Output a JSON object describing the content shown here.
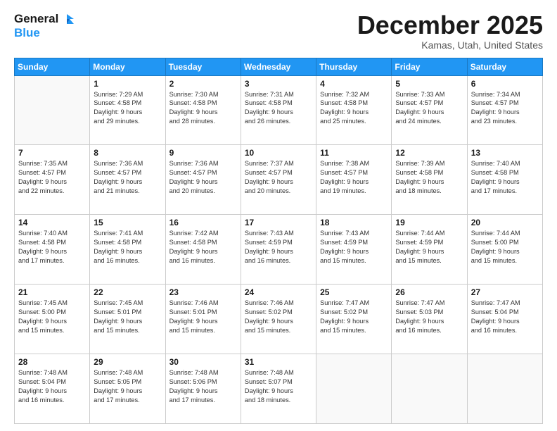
{
  "header": {
    "logo_line1": "General",
    "logo_line2": "Blue",
    "month_title": "December 2025",
    "location": "Kamas, Utah, United States"
  },
  "weekdays": [
    "Sunday",
    "Monday",
    "Tuesday",
    "Wednesday",
    "Thursday",
    "Friday",
    "Saturday"
  ],
  "weeks": [
    [
      {
        "day": "",
        "info": ""
      },
      {
        "day": "1",
        "info": "Sunrise: 7:29 AM\nSunset: 4:58 PM\nDaylight: 9 hours\nand 29 minutes."
      },
      {
        "day": "2",
        "info": "Sunrise: 7:30 AM\nSunset: 4:58 PM\nDaylight: 9 hours\nand 28 minutes."
      },
      {
        "day": "3",
        "info": "Sunrise: 7:31 AM\nSunset: 4:58 PM\nDaylight: 9 hours\nand 26 minutes."
      },
      {
        "day": "4",
        "info": "Sunrise: 7:32 AM\nSunset: 4:58 PM\nDaylight: 9 hours\nand 25 minutes."
      },
      {
        "day": "5",
        "info": "Sunrise: 7:33 AM\nSunset: 4:57 PM\nDaylight: 9 hours\nand 24 minutes."
      },
      {
        "day": "6",
        "info": "Sunrise: 7:34 AM\nSunset: 4:57 PM\nDaylight: 9 hours\nand 23 minutes."
      }
    ],
    [
      {
        "day": "7",
        "info": "Sunrise: 7:35 AM\nSunset: 4:57 PM\nDaylight: 9 hours\nand 22 minutes."
      },
      {
        "day": "8",
        "info": "Sunrise: 7:36 AM\nSunset: 4:57 PM\nDaylight: 9 hours\nand 21 minutes."
      },
      {
        "day": "9",
        "info": "Sunrise: 7:36 AM\nSunset: 4:57 PM\nDaylight: 9 hours\nand 20 minutes."
      },
      {
        "day": "10",
        "info": "Sunrise: 7:37 AM\nSunset: 4:57 PM\nDaylight: 9 hours\nand 20 minutes."
      },
      {
        "day": "11",
        "info": "Sunrise: 7:38 AM\nSunset: 4:57 PM\nDaylight: 9 hours\nand 19 minutes."
      },
      {
        "day": "12",
        "info": "Sunrise: 7:39 AM\nSunset: 4:58 PM\nDaylight: 9 hours\nand 18 minutes."
      },
      {
        "day": "13",
        "info": "Sunrise: 7:40 AM\nSunset: 4:58 PM\nDaylight: 9 hours\nand 17 minutes."
      }
    ],
    [
      {
        "day": "14",
        "info": "Sunrise: 7:40 AM\nSunset: 4:58 PM\nDaylight: 9 hours\nand 17 minutes."
      },
      {
        "day": "15",
        "info": "Sunrise: 7:41 AM\nSunset: 4:58 PM\nDaylight: 9 hours\nand 16 minutes."
      },
      {
        "day": "16",
        "info": "Sunrise: 7:42 AM\nSunset: 4:58 PM\nDaylight: 9 hours\nand 16 minutes."
      },
      {
        "day": "17",
        "info": "Sunrise: 7:43 AM\nSunset: 4:59 PM\nDaylight: 9 hours\nand 16 minutes."
      },
      {
        "day": "18",
        "info": "Sunrise: 7:43 AM\nSunset: 4:59 PM\nDaylight: 9 hours\nand 15 minutes."
      },
      {
        "day": "19",
        "info": "Sunrise: 7:44 AM\nSunset: 4:59 PM\nDaylight: 9 hours\nand 15 minutes."
      },
      {
        "day": "20",
        "info": "Sunrise: 7:44 AM\nSunset: 5:00 PM\nDaylight: 9 hours\nand 15 minutes."
      }
    ],
    [
      {
        "day": "21",
        "info": "Sunrise: 7:45 AM\nSunset: 5:00 PM\nDaylight: 9 hours\nand 15 minutes."
      },
      {
        "day": "22",
        "info": "Sunrise: 7:45 AM\nSunset: 5:01 PM\nDaylight: 9 hours\nand 15 minutes."
      },
      {
        "day": "23",
        "info": "Sunrise: 7:46 AM\nSunset: 5:01 PM\nDaylight: 9 hours\nand 15 minutes."
      },
      {
        "day": "24",
        "info": "Sunrise: 7:46 AM\nSunset: 5:02 PM\nDaylight: 9 hours\nand 15 minutes."
      },
      {
        "day": "25",
        "info": "Sunrise: 7:47 AM\nSunset: 5:02 PM\nDaylight: 9 hours\nand 15 minutes."
      },
      {
        "day": "26",
        "info": "Sunrise: 7:47 AM\nSunset: 5:03 PM\nDaylight: 9 hours\nand 16 minutes."
      },
      {
        "day": "27",
        "info": "Sunrise: 7:47 AM\nSunset: 5:04 PM\nDaylight: 9 hours\nand 16 minutes."
      }
    ],
    [
      {
        "day": "28",
        "info": "Sunrise: 7:48 AM\nSunset: 5:04 PM\nDaylight: 9 hours\nand 16 minutes."
      },
      {
        "day": "29",
        "info": "Sunrise: 7:48 AM\nSunset: 5:05 PM\nDaylight: 9 hours\nand 17 minutes."
      },
      {
        "day": "30",
        "info": "Sunrise: 7:48 AM\nSunset: 5:06 PM\nDaylight: 9 hours\nand 17 minutes."
      },
      {
        "day": "31",
        "info": "Sunrise: 7:48 AM\nSunset: 5:07 PM\nDaylight: 9 hours\nand 18 minutes."
      },
      {
        "day": "",
        "info": ""
      },
      {
        "day": "",
        "info": ""
      },
      {
        "day": "",
        "info": ""
      }
    ]
  ]
}
